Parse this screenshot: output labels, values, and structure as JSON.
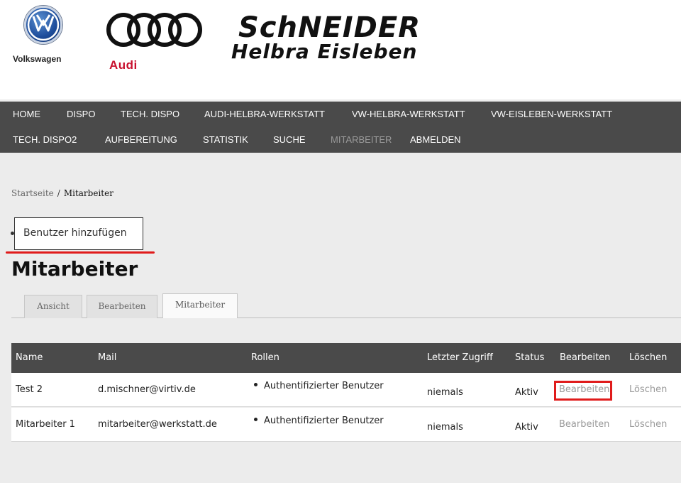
{
  "header": {
    "logos": {
      "vw": {
        "text": "Volkswagen",
        "icon": "vw-logo-icon"
      },
      "audi": {
        "text": "Audi",
        "icon": "audi-rings-icon",
        "color": "#c8102e"
      },
      "schneider": {
        "line1": "SchNEIDER",
        "line2": "Helbra Eisleben"
      }
    }
  },
  "nav": {
    "row1": [
      "HOME",
      "DISPO",
      "TECH. DISPO",
      "AUDI-HELBRA-WERKSTATT",
      "VW-HELBRA-WERKSTATT",
      "VW-EISLEBEN-WERKSTATT"
    ],
    "row2": [
      "TECH. DISPO2",
      "AUFBEREITUNG",
      "STATISTIK",
      "SUCHE",
      "MITARBEITER",
      "ABMELDEN"
    ],
    "active": "MITARBEITER"
  },
  "breadcrumb": {
    "home": "Startseite",
    "separator": "/",
    "current": "Mitarbeiter"
  },
  "add_user": {
    "label": "Benutzer hinzufügen"
  },
  "page_title": "Mitarbeiter",
  "tabs": [
    {
      "label": "Ansicht",
      "active": false
    },
    {
      "label": "Bearbeiten",
      "active": false
    },
    {
      "label": "Mitarbeiter",
      "active": true
    }
  ],
  "table": {
    "headers": [
      "Name",
      "Mail",
      "Rollen",
      "Letzter Zugriff",
      "Status",
      "Bearbeiten",
      "Löschen"
    ],
    "rows": [
      {
        "name": "Test 2",
        "mail": "d.mischner@virtiv.de",
        "role": "Authentifizierter Benutzer",
        "last_access": "niemals",
        "status": "Aktiv",
        "edit": "Bearbeiten",
        "delete": "Löschen"
      },
      {
        "name": "Mitarbeiter 1",
        "mail": "mitarbeiter@werkstatt.de",
        "role": "Authentifizierter Benutzer",
        "last_access": "niemals",
        "status": "Aktiv",
        "edit": "Bearbeiten",
        "delete": "Löschen"
      }
    ]
  },
  "colors": {
    "nav_bg": "#4a4a4a",
    "highlight": "#e01b1b",
    "background": "#ececec"
  }
}
